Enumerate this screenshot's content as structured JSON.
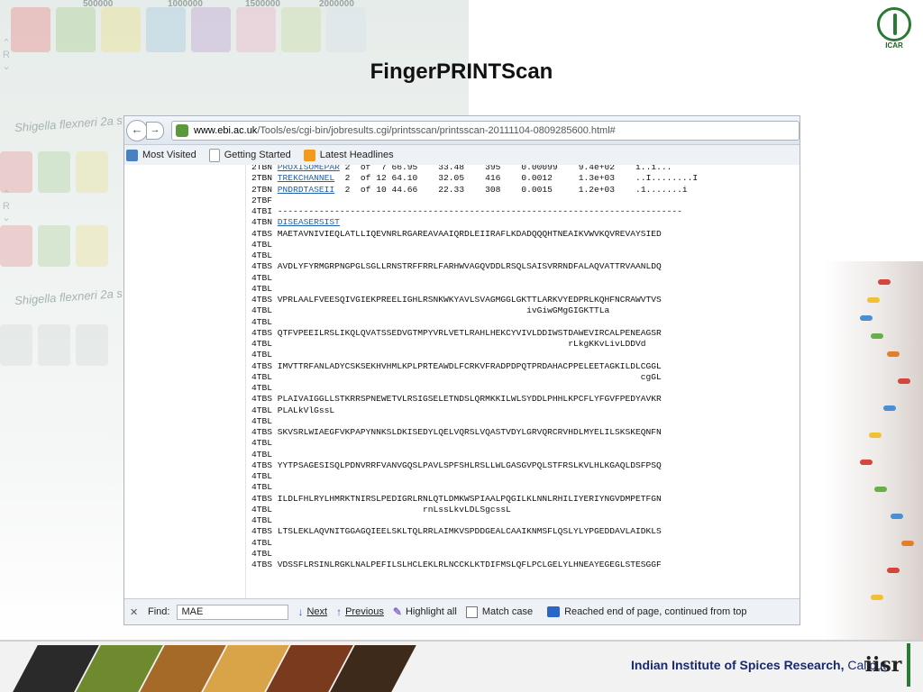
{
  "slide": {
    "title": "FingerPRINTScan",
    "ruler_labels": [
      "500000",
      "1000000",
      "1500000",
      "2000000"
    ],
    "organism_labels": [
      "Shigella flexneri 2a s",
      "Shigella flexneri 2a s"
    ],
    "side_nav": [
      "R",
      "R"
    ],
    "icar_label": "ICAR",
    "institute_name": "Indian Institute of Spices Research,",
    "institute_city": "Calicut",
    "iisr_logo": "iisr"
  },
  "browser": {
    "url_domain": "www.ebi.ac.uk",
    "url_path": "/Tools/es/cgi-bin/jobresults.cgi/printsscan/printsscan-20111104-0809285600.html#",
    "bookmarks": [
      {
        "label": "Most Visited",
        "icon": "bookmark-star-icon"
      },
      {
        "label": "Getting Started",
        "icon": "page-icon"
      },
      {
        "label": "Latest Headlines",
        "icon": "rss-icon"
      }
    ],
    "find_bar": {
      "label": "Find:",
      "value": "MAE",
      "next": "Next",
      "previous": "Previous",
      "highlight_all": "Highlight all",
      "match_case": "Match case",
      "status": "Reached end of page, continued from top"
    }
  },
  "results_table": {
    "hits": [
      {
        "code": "2TBN",
        "name": "PROXISOMEPAR",
        "n": "2",
        "of": "of",
        "total": "7",
        "score": "66.95",
        "pct": "33.48",
        "len": "395",
        "pval": "0.00099",
        "eval": "9.4e+02",
        "pattern": "i..i..."
      },
      {
        "code": "2TBN",
        "name": "TREKCHANNEL",
        "n": "2",
        "of": "of",
        "total": "12",
        "score": "64.10",
        "pct": "32.05",
        "len": "416",
        "pval": "0.0012",
        "eval": "1.3e+03",
        "pattern": "..I........I"
      },
      {
        "code": "2TBN",
        "name": "PNDRDTASEII",
        "n": "2",
        "of": "of",
        "total": "10",
        "score": "44.66",
        "pct": "22.33",
        "len": "308",
        "pval": "0.0015",
        "eval": "1.2e+03",
        "pattern": ".1.......i"
      }
    ],
    "lines_after_hits": [
      "2TBF",
      "4TBI ------------------------------------------------------------------------------"
    ],
    "link_line_prefix": "4TBN ",
    "link_line_name": "DISEASERSIST",
    "alignment_lines": [
      "4TBS MAETAVNIVIEQLATLLIQEVNRLRGAREAVAAIQRDLEIIRAFLKDADQQQHTNEAIKVWVKQVREVAYSIED",
      "4TBL",
      "4TBL",
      "4TBS AVDLYFYRMGRPNGPGLSGLLRNSTRFFRRLFARHWVAGQVDDLRSQLSAISVRRNDFALAQVATTRVAANLDQ",
      "4TBL",
      "4TBL",
      "4TBS VPRLAALFVEESQIVGIEKPREELIGHLRSNKWKYAVLSVAGMGGLGKTTLARKVYEDPRLKQHFNCRAWVTVS",
      "4TBL                                                 ivGiwGMgGIGKTTLa",
      "4TBL",
      "4TBS QTFVPEEILRSLIKQLQVATSSEDVGTMPYVRLVETLRAHLHEKCYVIVLDDIWSTDAWEVIRCALPENEAGSR",
      "4TBL                                                         rLkgKKvLivLDDVd",
      "4TBL",
      "4TBS IMVTTRFANLADYCSKSEKHVHMLKPLPRTEAWDLFCRKVFRADPDPQTPRDAHACPPELEETAGKILDLCGGL",
      "4TBL                                                                       cgGL",
      "4TBL",
      "4TBS PLAIVAIGGLLSTKRRSPNEWETVLRSIGSELETNDSLQRMKKILWLSYDDLPHHLKPCFLYFGVFPEDYAVKR",
      "4TBL PLALkVlGssL",
      "4TBL",
      "4TBS SKVSRLWIAEGFVKPAPYNNKSLDKISEDYLQELVQRSLVQASTVDYLGRVQRCRVHDLMYELILSKSKEQNFN",
      "4TBL",
      "4TBL",
      "4TBS YYTPSAGESISQLPDNVRRFVANVGQSLPAVLSPFSHLRSLLWLGASGVPQLSTFRSLKVLHLKGAQLDSFPSQ",
      "4TBL",
      "4TBL",
      "4TBS ILDLFHLRYLHMRKTNIRSLPEDIGRLRNLQTLDMKWSPIAALPQGILKLNNLRHILIYERIYNGVDMPETFGN",
      "4TBL                             rnLssLkvLDLSgcssL",
      "4TBL",
      "4TBS LTSLEKLAQVNITGGAGQIEELSKLTQLRRLAIMKVSPDDGEALCAAIKNMSFLQSLYLYPGEDDAVLAIDKLS",
      "4TBL",
      "4TBL",
      "4TBS VDSSFLRSINLRGKLNALPEFILSLHCLEKLRLNCCKLKTDIFMSLQFLPCLGELYLHNEAYEGEGLSTESGGF"
    ]
  },
  "colors": {
    "link": "#1d5fb0",
    "title": "#111111",
    "institute": "#1a2a6c",
    "icar_green": "#2a7a35"
  }
}
